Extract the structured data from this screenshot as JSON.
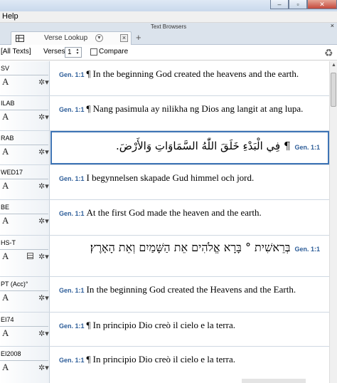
{
  "menu": {
    "help": "Help"
  },
  "panel": {
    "title": "Text Browsers",
    "close": "×"
  },
  "tab": {
    "label": "Verse Lookup",
    "close": "×",
    "add": "+"
  },
  "toolbar": {
    "source": "[All Texts]",
    "verses_label": "Verses:",
    "verses_value": "1",
    "compare_label": "Compare"
  },
  "rows": [
    {
      "abbr": "SV",
      "font": "A",
      "ref": "Gen. 1:1",
      "text": "¶ In the beginning God created the heavens and the earth."
    },
    {
      "abbr": "ILAB",
      "font": "A",
      "ref": "Gen. 1:1",
      "text": "¶ Nang pasimula ay nilikha ng Dios ang langit at ang lupa."
    },
    {
      "abbr": "RAB",
      "font": "A",
      "ref": "Gen. 1:1",
      "text": "¶ فِي الْبَدْءِ خَلَقَ اللّٰهُ السَّمَاوَاتِ وَالأَرْضَ."
    },
    {
      "abbr": "WED17",
      "font": "A",
      "ref": "Gen. 1:1",
      "text": "I begynnelsen skapade Gud himmel och jord."
    },
    {
      "abbr": "BE",
      "font": "A",
      "ref": "Gen. 1:1",
      "text": "At the first God made the heaven and the earth."
    },
    {
      "abbr": "HS-T",
      "font": "A",
      "ref": "Gen. 1:1",
      "text": "בְּרֵאשִׁית ° בָּרָא אֱלֹהִים אֵת הַשָּׁמַיִם וְאֵת הָאָרֶץ׃"
    },
    {
      "abbr": "PT (Acc)°",
      "font": "A",
      "ref": "Gen. 1:1",
      "text": "In the beginning God created the Heavens and the Earth."
    },
    {
      "abbr": "EI74",
      "font": "A",
      "ref": "Gen. 1:1",
      "text": "¶ In principio Dio creò il cielo e la terra."
    },
    {
      "abbr": "EI2008",
      "font": "A",
      "ref": "Gen. 1:1",
      "text": "¶ In principio Dio creò il cielo e la terra."
    }
  ]
}
